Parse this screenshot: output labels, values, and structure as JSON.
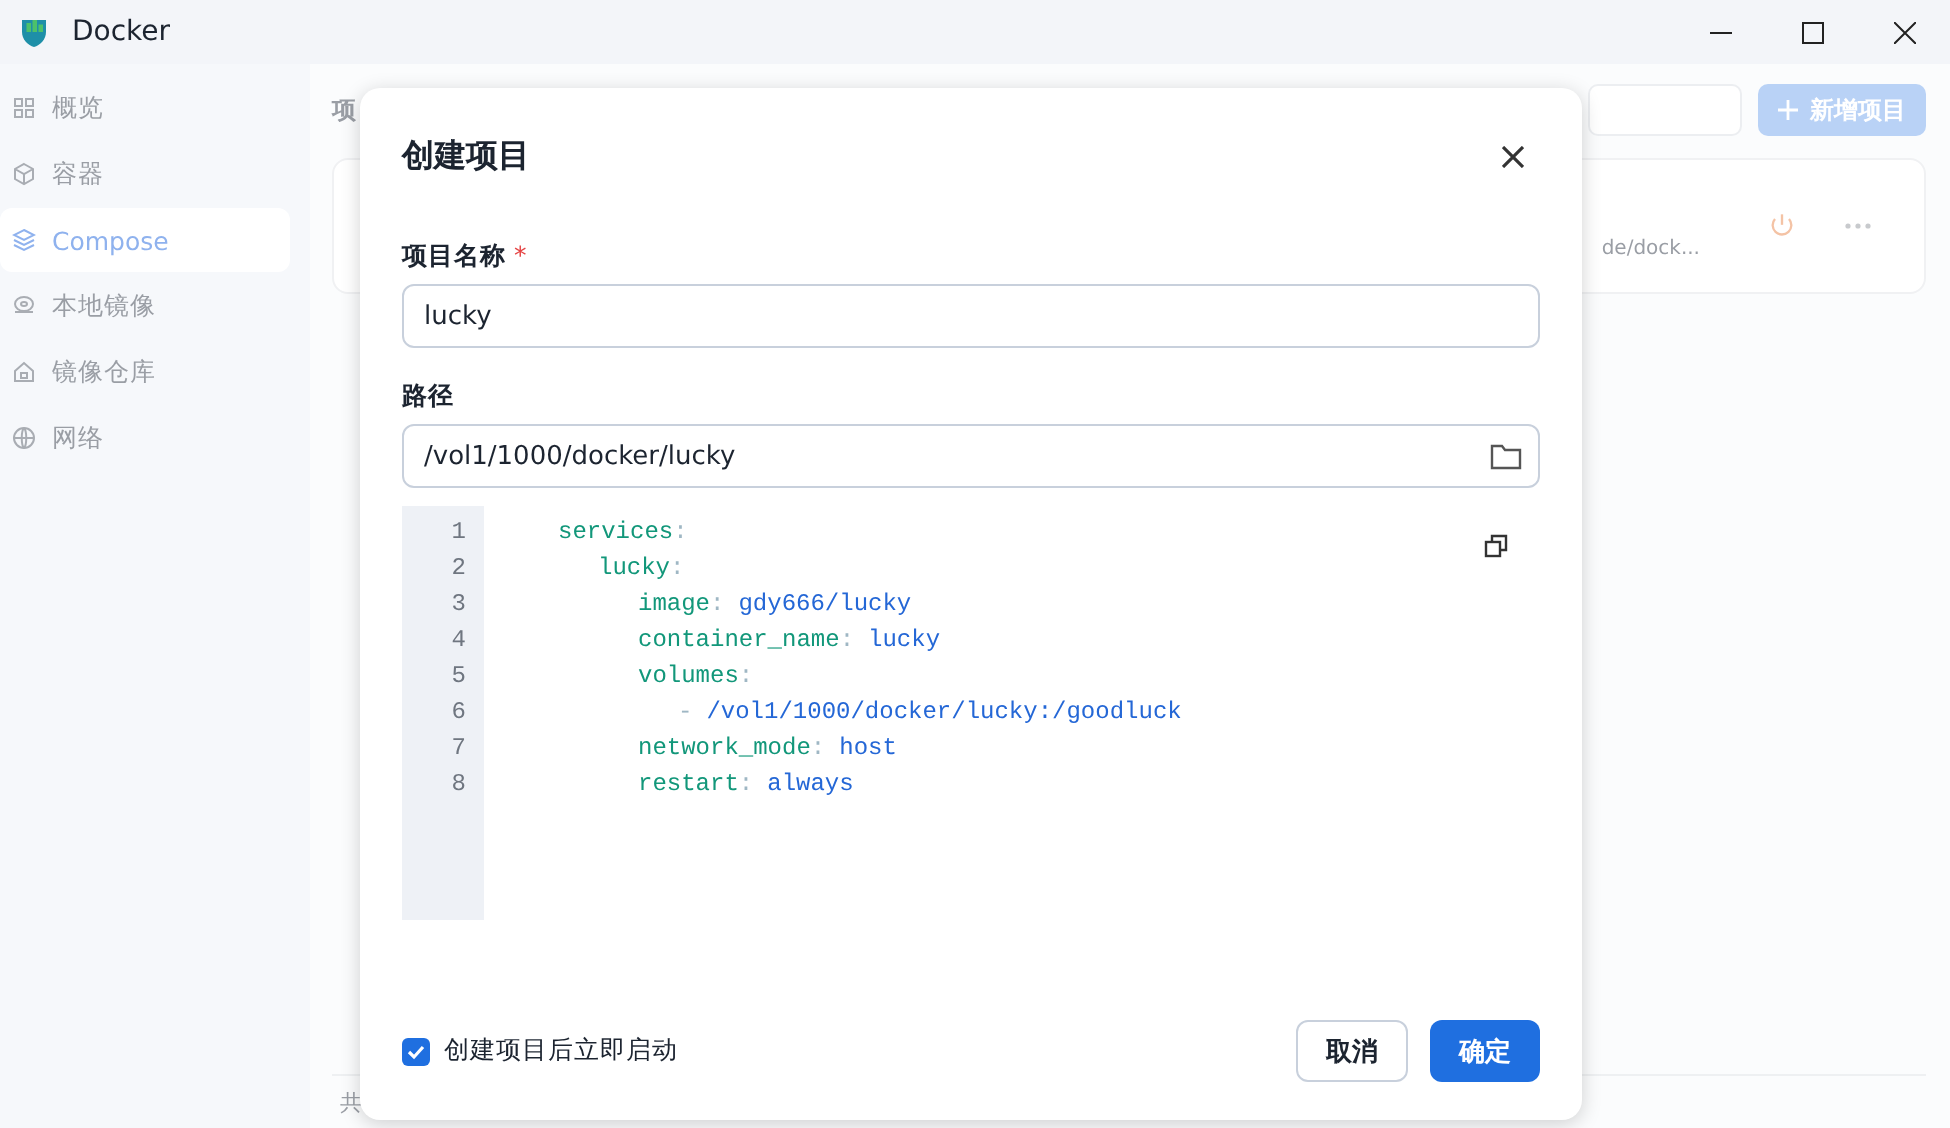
{
  "window": {
    "title": "Docker"
  },
  "sidebar": {
    "items": [
      {
        "label": "概览",
        "selected": false
      },
      {
        "label": "容器",
        "selected": false
      },
      {
        "label": "Compose",
        "selected": true
      },
      {
        "label": "本地镜像",
        "selected": false
      },
      {
        "label": "镜像仓库",
        "selected": false
      },
      {
        "label": "网络",
        "selected": false
      }
    ]
  },
  "main": {
    "heading": "项",
    "add_button": "新增项目",
    "project_card": {
      "path": "de/dock..."
    },
    "footer": "共"
  },
  "dialog": {
    "title": "创建项目",
    "name_field": {
      "label": "项目名称",
      "required_mark": "*",
      "value": "lucky"
    },
    "path_field": {
      "label": "路径",
      "value": "/vol1/1000/docker/lucky"
    },
    "code": [
      {
        "line": "1",
        "key": "services",
        "sep": ":",
        "children": [
          {
            "line": "2",
            "key": "lucky",
            "sep": ":",
            "children": [
              {
                "line": "3",
                "key": "image",
                "sep": ":",
                "value": "gdy666/lucky"
              },
              {
                "line": "4",
                "key": "container_name",
                "sep": ":",
                "value": "lucky"
              },
              {
                "line": "5",
                "key": "volumes",
                "sep": ":",
                "children": [
                  {
                    "line": "6",
                    "marker": "-",
                    "value": "/vol1/1000/docker/lucky:/goodluck"
                  }
                ]
              },
              {
                "line": "7",
                "key": "network_mode",
                "sep": ":",
                "value": "host"
              },
              {
                "line": "8",
                "key": "restart",
                "sep": ":",
                "value": "always"
              }
            ]
          }
        ]
      }
    ],
    "start_after_create": {
      "label": "创建项目后立即启动",
      "checked": true
    },
    "buttons": [
      {
        "label": "取消",
        "kind": "secondary"
      },
      {
        "label": "确定",
        "kind": "primary"
      }
    ]
  }
}
